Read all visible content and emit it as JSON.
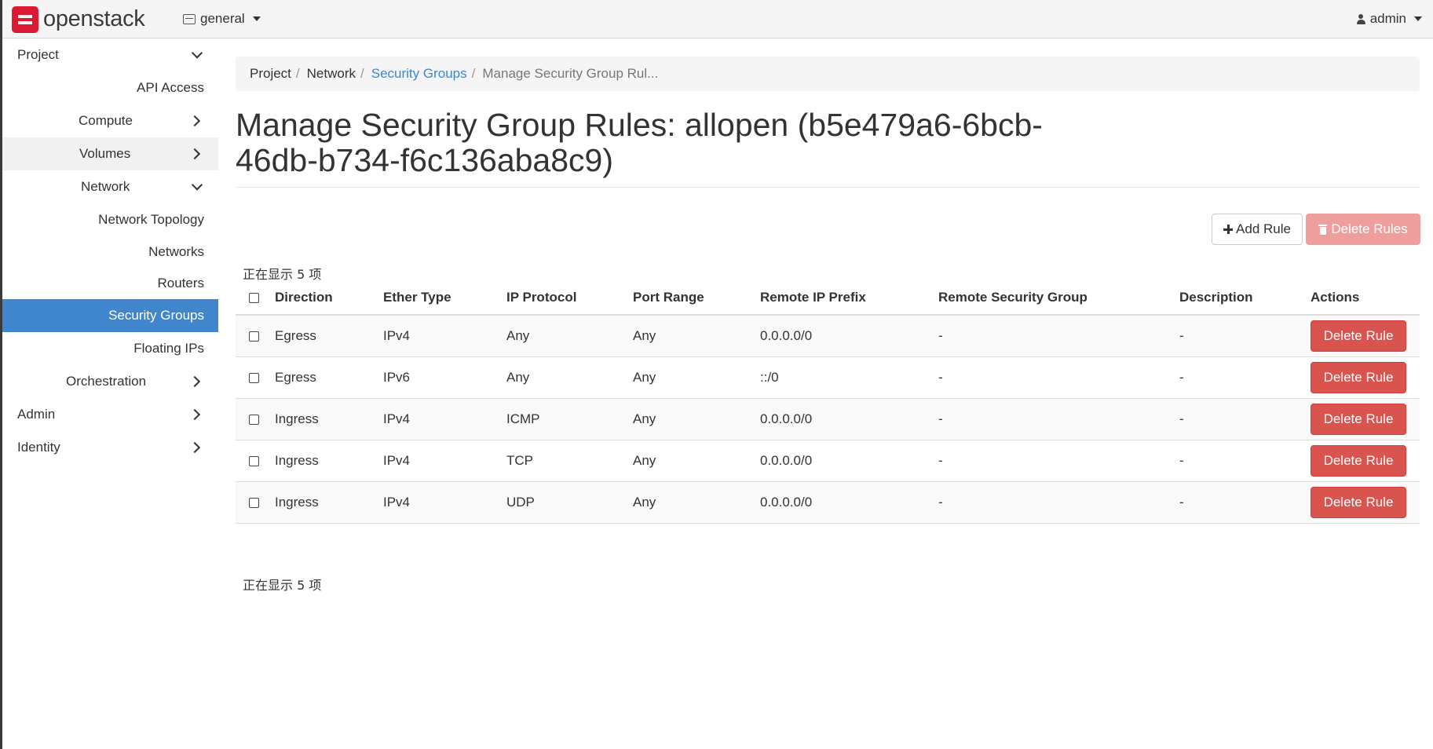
{
  "navbar": {
    "brand": "openstack",
    "project": "general",
    "user": "admin"
  },
  "sidebar": {
    "items": [
      {
        "label": "Project"
      },
      {
        "label": "API Access"
      },
      {
        "label": "Compute"
      },
      {
        "label": "Volumes"
      },
      {
        "label": "Network"
      },
      {
        "label": "Network Topology"
      },
      {
        "label": "Networks"
      },
      {
        "label": "Routers"
      },
      {
        "label": "Security Groups"
      },
      {
        "label": "Floating IPs"
      },
      {
        "label": "Orchestration"
      },
      {
        "label": "Admin"
      },
      {
        "label": "Identity"
      }
    ]
  },
  "breadcrumb": {
    "items": [
      "Project",
      "Network",
      "Security Groups",
      "Manage Security Group Rul..."
    ],
    "separator": "/"
  },
  "page": {
    "title": "Manage Security Group Rules: allopen (b5e479a6-6bcb-46db-b734-f6c136aba8c9)"
  },
  "toolbar": {
    "add_label": "Add Rule",
    "delete_all_label": "Delete Rules"
  },
  "table": {
    "count_text": "正在显示 5 项",
    "columns": [
      "Direction",
      "Ether Type",
      "IP Protocol",
      "Port Range",
      "Remote IP Prefix",
      "Remote Security Group",
      "Description",
      "Actions"
    ],
    "rows": [
      {
        "direction": "Egress",
        "ether": "IPv4",
        "protocol": "Any",
        "port": "Any",
        "prefix": "0.0.0.0/0",
        "remote_group": "-",
        "description": "-",
        "action": "Delete Rule"
      },
      {
        "direction": "Egress",
        "ether": "IPv6",
        "protocol": "Any",
        "port": "Any",
        "prefix": "::/0",
        "remote_group": "-",
        "description": "-",
        "action": "Delete Rule"
      },
      {
        "direction": "Ingress",
        "ether": "IPv4",
        "protocol": "ICMP",
        "port": "Any",
        "prefix": "0.0.0.0/0",
        "remote_group": "-",
        "description": "-",
        "action": "Delete Rule"
      },
      {
        "direction": "Ingress",
        "ether": "IPv4",
        "protocol": "TCP",
        "port": "Any",
        "prefix": "0.0.0.0/0",
        "remote_group": "-",
        "description": "-",
        "action": "Delete Rule"
      },
      {
        "direction": "Ingress",
        "ether": "IPv4",
        "protocol": "UDP",
        "port": "Any",
        "prefix": "0.0.0.0/0",
        "remote_group": "-",
        "description": "-",
        "action": "Delete Rule"
      }
    ]
  },
  "colors": {
    "accent": "#3f86cc",
    "danger": "#d9534f",
    "danger_disabled": "#ee9e9c",
    "brand_red": "#da1a32"
  }
}
